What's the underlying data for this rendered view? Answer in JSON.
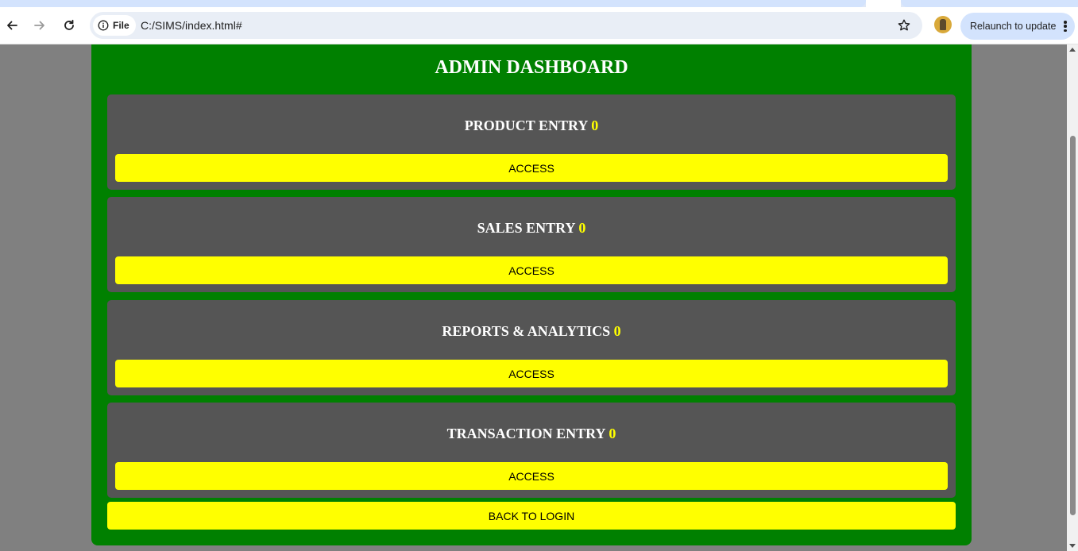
{
  "browser": {
    "url": "C:/SIMS/index.html#",
    "scheme_chip": "File",
    "relaunch_label": "Relaunch to update",
    "icons": [
      "back-arrow-icon",
      "forward-arrow-icon",
      "reload-icon",
      "info-icon",
      "star-icon",
      "avatar",
      "kebab-menu-icon"
    ]
  },
  "dashboard": {
    "title": "ADMIN DASHBOARD",
    "cards": [
      {
        "label": "PRODUCT ENTRY",
        "count": "0",
        "button": "ACCESS"
      },
      {
        "label": "SALES ENTRY",
        "count": "0",
        "button": "ACCESS"
      },
      {
        "label": "REPORTS & ANALYTICS",
        "count": "0",
        "button": "ACCESS"
      },
      {
        "label": "TRANSACTION ENTRY",
        "count": "0",
        "button": "ACCESS"
      }
    ],
    "back_button": "BACK TO LOGIN"
  },
  "colors": {
    "page_background": "#808080",
    "dashboard_background": "#008000",
    "card_background": "#555555",
    "button_background": "#ffff00",
    "count_color": "#ffff00",
    "title_color": "#ffffff"
  }
}
